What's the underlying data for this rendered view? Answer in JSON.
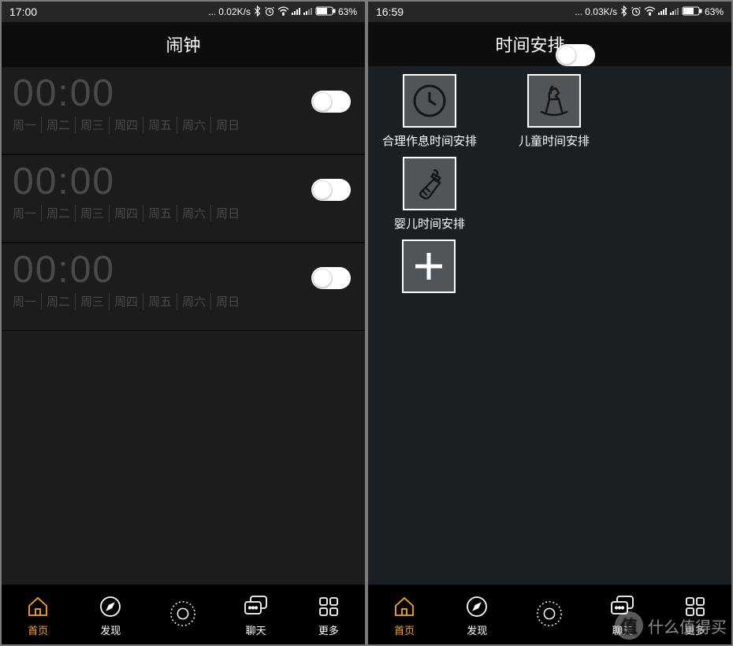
{
  "left": {
    "status": {
      "time": "17:00",
      "net": "0.02K/s",
      "battery": "63%"
    },
    "header": {
      "title": "闹钟"
    },
    "alarms": [
      {
        "time": "00:00",
        "days": [
          "周一",
          "周二",
          "周三",
          "周四",
          "周五",
          "周六",
          "周日"
        ],
        "on": false
      },
      {
        "time": "00:00",
        "days": [
          "周一",
          "周二",
          "周三",
          "周四",
          "周五",
          "周六",
          "周日"
        ],
        "on": false
      },
      {
        "time": "00:00",
        "days": [
          "周一",
          "周二",
          "周三",
          "周四",
          "周五",
          "周六",
          "周日"
        ],
        "on": false
      }
    ],
    "nav": {
      "home": "首页",
      "discover": "发现",
      "center": "",
      "chat": "聊天",
      "more": "更多"
    }
  },
  "right": {
    "status": {
      "time": "16:59",
      "net": "0.03K/s",
      "battery": "63%"
    },
    "header": {
      "title": "时间安排",
      "toggle_on": false
    },
    "schedules": [
      {
        "label": "合理作息时间安排",
        "icon": "clock"
      },
      {
        "label": "儿童时间安排",
        "icon": "rocking-horse"
      },
      {
        "label": "婴儿时间安排",
        "icon": "baby-bottle"
      }
    ],
    "add_label": "+",
    "nav": {
      "home": "首页",
      "discover": "发现",
      "center": "",
      "chat": "聊天",
      "more": "更多"
    }
  },
  "watermark": "什么值得买"
}
